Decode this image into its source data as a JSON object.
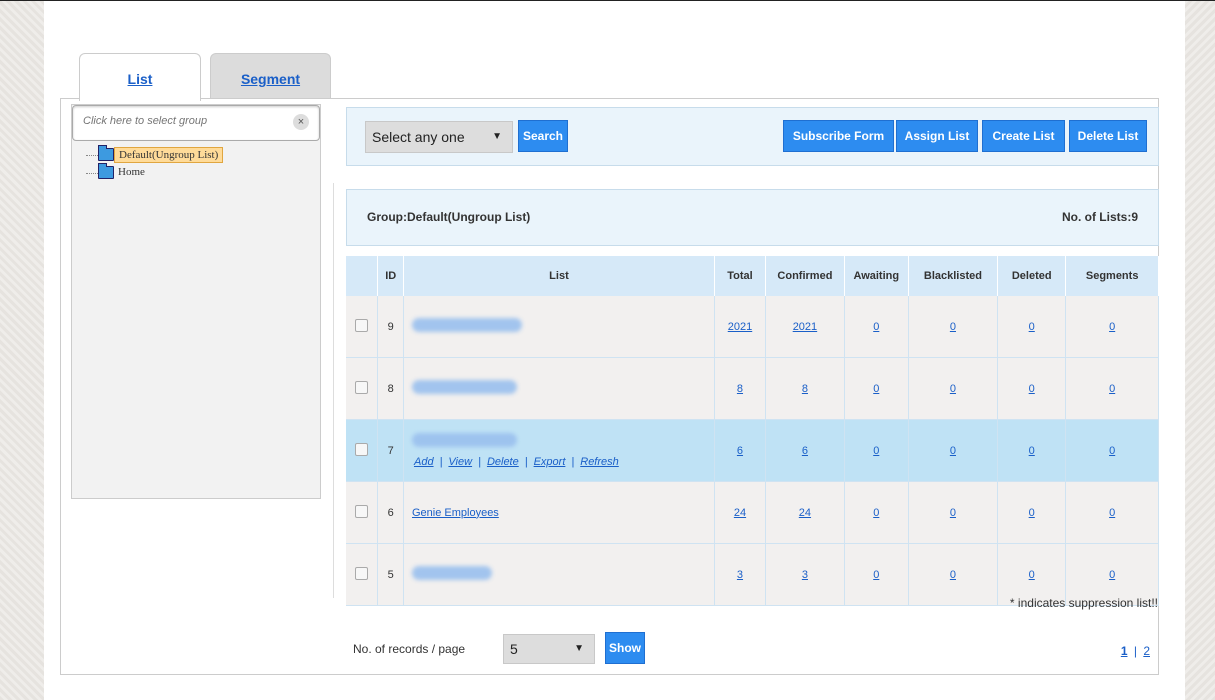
{
  "tabs": [
    {
      "label": "List",
      "active": true
    },
    {
      "label": "Segment",
      "active": false
    }
  ],
  "group_search": {
    "placeholder": "Click here to select group",
    "clear_icon": "×"
  },
  "tree": [
    {
      "label": "Default(Ungroup List)",
      "selected": true
    },
    {
      "label": "Home",
      "selected": false
    }
  ],
  "toolbar": {
    "select_value": "Select any one",
    "search_label": "Search",
    "subscribe_form_label": "Subscribe Form",
    "assign_list_label": "Assign List",
    "create_list_label": "Create List",
    "delete_list_label": "Delete List"
  },
  "group_bar": {
    "group_label": "Group:Default(Ungroup List)",
    "count_label": "No. of Lists:9"
  },
  "table": {
    "columns": [
      "ID",
      "List",
      "Total",
      "Confirmed",
      "Awaiting",
      "Blacklisted",
      "Deleted",
      "Segments"
    ],
    "rows": [
      {
        "id": "9",
        "name": "",
        "total": "2021",
        "confirmed": "2021",
        "awaiting": "0",
        "blacklisted": "0",
        "deleted": "0",
        "segments": "0"
      },
      {
        "id": "8",
        "name": "",
        "total": "8",
        "confirmed": "8",
        "awaiting": "0",
        "blacklisted": "0",
        "deleted": "0",
        "segments": "0"
      },
      {
        "id": "7",
        "name": "",
        "total": "6",
        "confirmed": "6",
        "awaiting": "0",
        "blacklisted": "0",
        "deleted": "0",
        "segments": "0",
        "actions": [
          "Add",
          "View",
          "Delete",
          "Export",
          "Refresh"
        ]
      },
      {
        "id": "6",
        "name": "Genie Employees",
        "total": "24",
        "confirmed": "24",
        "awaiting": "0",
        "blacklisted": "0",
        "deleted": "0",
        "segments": "0"
      },
      {
        "id": "5",
        "name": "",
        "total": "3",
        "confirmed": "3",
        "awaiting": "0",
        "blacklisted": "0",
        "deleted": "0",
        "segments": "0"
      }
    ]
  },
  "note": "* indicates suppression list!!",
  "footer": {
    "records_label": "No. of records / page",
    "records_value": "5",
    "show_label": "Show",
    "pages": [
      "1",
      "2"
    ],
    "current_page": "1",
    "page_separator": "|"
  }
}
